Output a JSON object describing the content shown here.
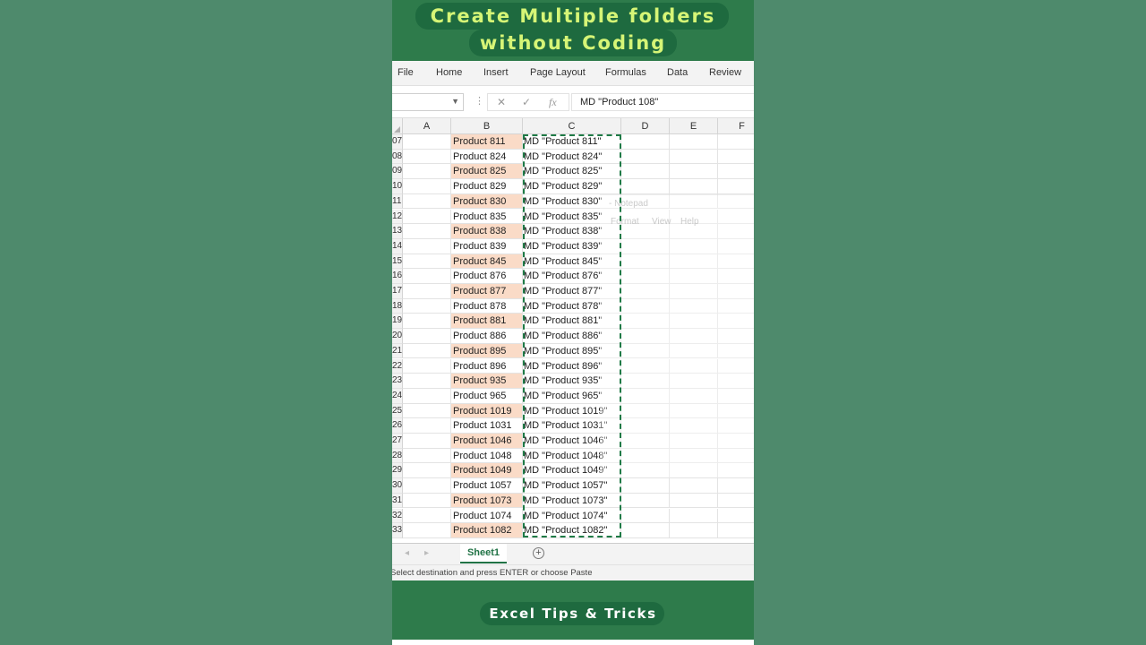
{
  "banner": {
    "title_line1": "Create Multiple folders",
    "title_line2": "without Coding",
    "footer": "Excel Tips & Tricks"
  },
  "ribbon": {
    "tabs": [
      "File",
      "Home",
      "Insert",
      "Page Layout",
      "Formulas",
      "Data",
      "Review"
    ]
  },
  "formula_bar": {
    "name_box": "",
    "cancel_icon": "✕",
    "enter_icon": "✓",
    "fx_label": "fx",
    "value": "MD \"Product 108\""
  },
  "columns": [
    "A",
    "B",
    "C",
    "D",
    "E",
    "F"
  ],
  "rows": [
    {
      "num": "07",
      "b": "Product 811",
      "c": "MD \"Product 811\"",
      "hl": true
    },
    {
      "num": "08",
      "b": "Product 824",
      "c": "MD \"Product 824\"",
      "hl": false
    },
    {
      "num": "09",
      "b": "Product 825",
      "c": "MD \"Product 825\"",
      "hl": true
    },
    {
      "num": "10",
      "b": "Product 829",
      "c": "MD \"Product 829\"",
      "hl": false
    },
    {
      "num": "11",
      "b": "Product 830",
      "c": "MD \"Product 830\"",
      "hl": true
    },
    {
      "num": "12",
      "b": "Product 835",
      "c": "MD \"Product 835\"",
      "hl": false
    },
    {
      "num": "13",
      "b": "Product 838",
      "c": "MD \"Product 838\"",
      "hl": true
    },
    {
      "num": "14",
      "b": "Product 839",
      "c": "MD \"Product 839\"",
      "hl": false
    },
    {
      "num": "15",
      "b": "Product 845",
      "c": "MD \"Product 845\"",
      "hl": true
    },
    {
      "num": "16",
      "b": "Product 876",
      "c": "MD \"Product 876\"",
      "hl": false
    },
    {
      "num": "17",
      "b": "Product 877",
      "c": "MD \"Product 877\"",
      "hl": true
    },
    {
      "num": "18",
      "b": "Product 878",
      "c": "MD \"Product 878\"",
      "hl": false
    },
    {
      "num": "19",
      "b": "Product 881",
      "c": "MD \"Product 881\"",
      "hl": true
    },
    {
      "num": "20",
      "b": "Product 886",
      "c": "MD \"Product 886\"",
      "hl": false
    },
    {
      "num": "21",
      "b": "Product 895",
      "c": "MD \"Product 895\"",
      "hl": true
    },
    {
      "num": "22",
      "b": "Product 896",
      "c": "MD \"Product 896\"",
      "hl": false
    },
    {
      "num": "23",
      "b": "Product 935",
      "c": "MD \"Product 935\"",
      "hl": true
    },
    {
      "num": "24",
      "b": "Product 965",
      "c": "MD \"Product 965\"",
      "hl": false
    },
    {
      "num": "25",
      "b": "Product 1019",
      "c": "MD \"Product 1019\"",
      "hl": true
    },
    {
      "num": "26",
      "b": "Product 1031",
      "c": "MD \"Product 1031\"",
      "hl": false
    },
    {
      "num": "27",
      "b": "Product 1046",
      "c": "MD \"Product 1046\"",
      "hl": true
    },
    {
      "num": "28",
      "b": "Product 1048",
      "c": "MD \"Product 1048\"",
      "hl": false
    },
    {
      "num": "29",
      "b": "Product 1049",
      "c": "MD \"Product 1049\"",
      "hl": true
    },
    {
      "num": "30",
      "b": "Product 1057",
      "c": "MD \"Product 1057\"",
      "hl": false
    },
    {
      "num": "31",
      "b": "Product 1073",
      "c": "MD \"Product 1073\"",
      "hl": true
    },
    {
      "num": "32",
      "b": "Product 1074",
      "c": "MD \"Product 1074\"",
      "hl": false
    },
    {
      "num": "33",
      "b": "Product 1082",
      "c": "MD \"Product 1082\"",
      "hl": true
    }
  ],
  "ghost_window": {
    "title": "- Notepad",
    "menu": [
      "Format",
      "View",
      "Help"
    ]
  },
  "sheet_tabs": {
    "active": "Sheet1",
    "add_icon": "+"
  },
  "status_bar": {
    "text": "Select destination and press ENTER or choose Paste"
  },
  "colors": {
    "accent": "#217346",
    "highlight": "#fadbc7",
    "banner_text": "#d6f576"
  }
}
